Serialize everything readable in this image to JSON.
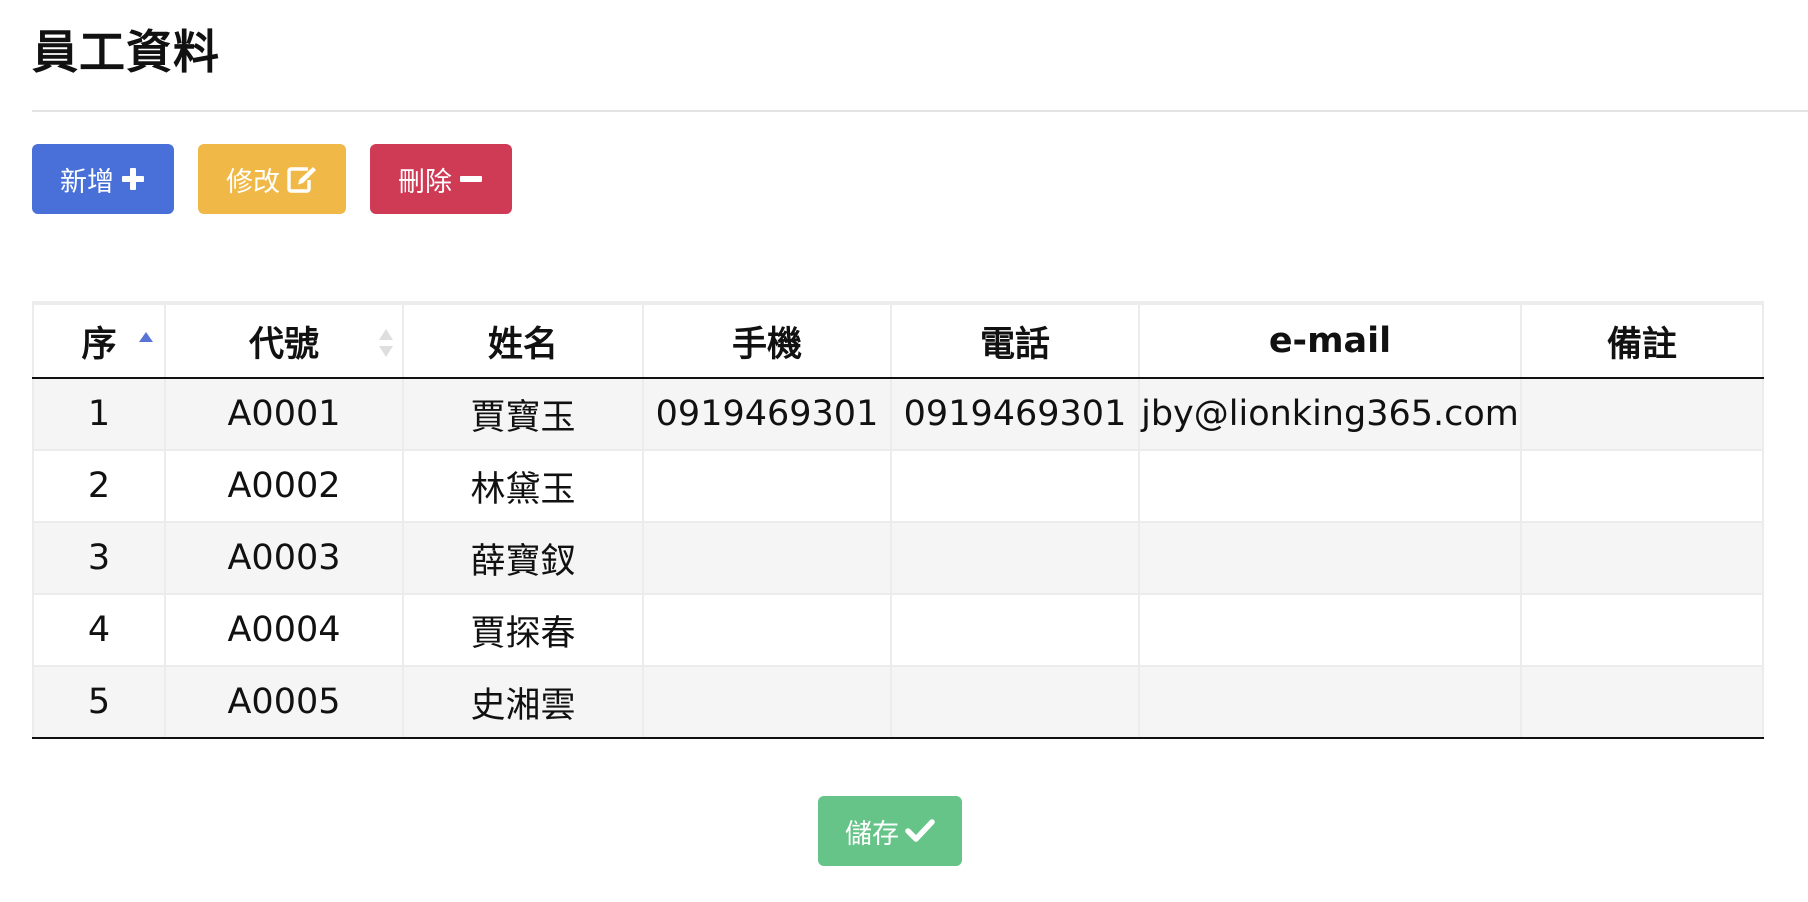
{
  "page": {
    "title": "員工資料"
  },
  "colors": {
    "add": "#4870d8",
    "edit": "#f0b846",
    "delete": "#cf3a55",
    "save": "#66c488",
    "sort_active": "#5a74d6"
  },
  "toolbar": {
    "add_label": "新增",
    "add_icon": "plus-icon",
    "edit_label": "修改",
    "edit_icon": "edit-icon",
    "delete_label": "刪除",
    "delete_icon": "minus-icon"
  },
  "table": {
    "columns": [
      {
        "label": "序",
        "sort": "asc"
      },
      {
        "label": "代號",
        "sort": "both"
      },
      {
        "label": "姓名"
      },
      {
        "label": "手機"
      },
      {
        "label": "電話"
      },
      {
        "label": "e-mail"
      },
      {
        "label": "備註"
      }
    ],
    "rows": [
      [
        "1",
        "A0001",
        "賈寶玉",
        "0919469301",
        "0919469301",
        "jby@lionking365.com",
        ""
      ],
      [
        "2",
        "A0002",
        "林黛玉",
        "",
        "",
        "",
        ""
      ],
      [
        "3",
        "A0003",
        "薛寶釵",
        "",
        "",
        "",
        ""
      ],
      [
        "4",
        "A0004",
        "賈探春",
        "",
        "",
        "",
        ""
      ],
      [
        "5",
        "A0005",
        "史湘雲",
        "",
        "",
        "",
        ""
      ]
    ]
  },
  "footer": {
    "save_label": "儲存",
    "save_icon": "check-icon"
  }
}
